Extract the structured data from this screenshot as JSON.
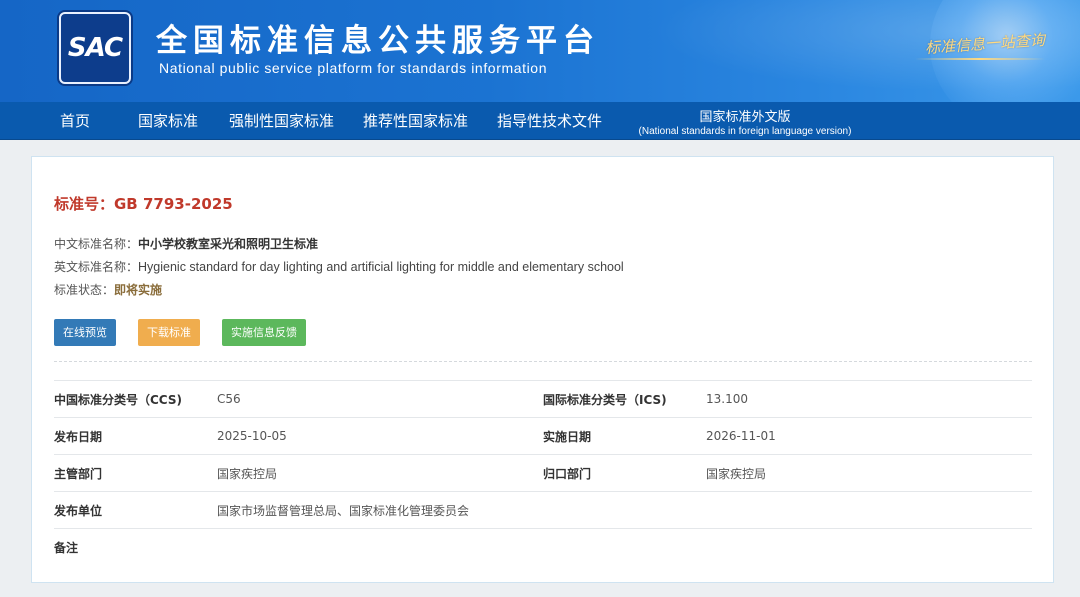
{
  "header": {
    "logo_text": "SAC",
    "title_cn": "全国标准信息公共服务平台",
    "title_en": "National public service platform  for standards information",
    "slogan": "标准信息一站查询"
  },
  "nav": {
    "items": [
      {
        "label": "首页"
      },
      {
        "label": "国家标准"
      },
      {
        "label": "强制性国家标准"
      },
      {
        "label": "推荐性国家标准"
      },
      {
        "label": "指导性技术文件"
      }
    ],
    "foreign": {
      "label_cn": "国家标准外文版",
      "label_en": "(National standards in foreign language version)"
    }
  },
  "standard": {
    "number_label": "标准号：GB 7793-2025",
    "cn_name_label": "中文标准名称：",
    "cn_name": "中小学校教室采光和照明卫生标准",
    "en_name_label": "英文标准名称：",
    "en_name": "Hygienic standard for day lighting and artificial lighting for middle and elementary school",
    "status_label": "标准状态：",
    "status": "即将实施"
  },
  "actions": {
    "preview": "在线预览",
    "download": "下载标准",
    "feedback": "实施信息反馈"
  },
  "details": {
    "ccs_label": "中国标准分类号（CCS)",
    "ccs": "C56",
    "ics_label": "国际标准分类号（ICS)",
    "ics": "13.100",
    "publish_label": "发布日期",
    "publish_date": "2025-10-05",
    "implement_label": "实施日期",
    "implement_date": "2026-11-01",
    "authority_label": "主管部门",
    "authority": "国家疾控局",
    "responsible_label": "归口部门",
    "responsible": "国家疾控局",
    "issuer_label": "发布单位",
    "issuer": "国家市场监督管理总局、国家标准化管理委员会",
    "remarks_label": "备注",
    "remarks": ""
  },
  "colors": {
    "banner": "#1b73d2",
    "nav": "#0a5aae",
    "std_number": "#c0392b",
    "btn_preview": "#337ab7",
    "btn_download": "#f0ad4e",
    "btn_feedback": "#5cb85c"
  }
}
